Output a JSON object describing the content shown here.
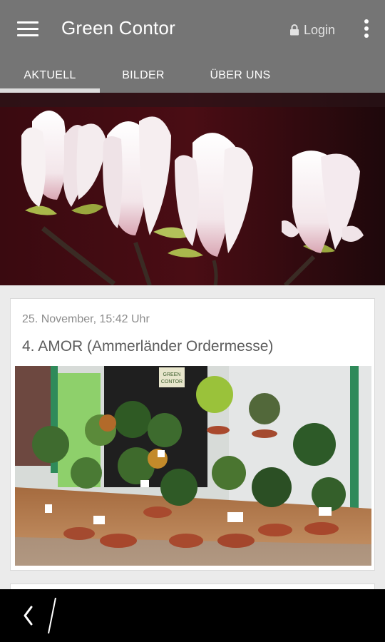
{
  "app": {
    "title": "Green Contor",
    "login_label": "Login"
  },
  "tabs": [
    {
      "label": "AKTUELL",
      "selected": true
    },
    {
      "label": "BILDER",
      "selected": false
    },
    {
      "label": "ÜBER UNS",
      "selected": false
    }
  ],
  "post": {
    "date": "25. November, 15:42 Uhr",
    "title": "4. AMOR (Ammerländer Ordermesse)",
    "sign_text_1": "GREEN",
    "sign_text_2": "CONTOR"
  },
  "icons": {
    "menu": "hamburger-menu-icon",
    "lock": "lock-icon",
    "overflow": "more-vert-icon",
    "back": "back-icon"
  },
  "colors": {
    "appbar": "#757575",
    "navbar": "#000000",
    "background": "#ebebeb",
    "card": "#ffffff"
  }
}
